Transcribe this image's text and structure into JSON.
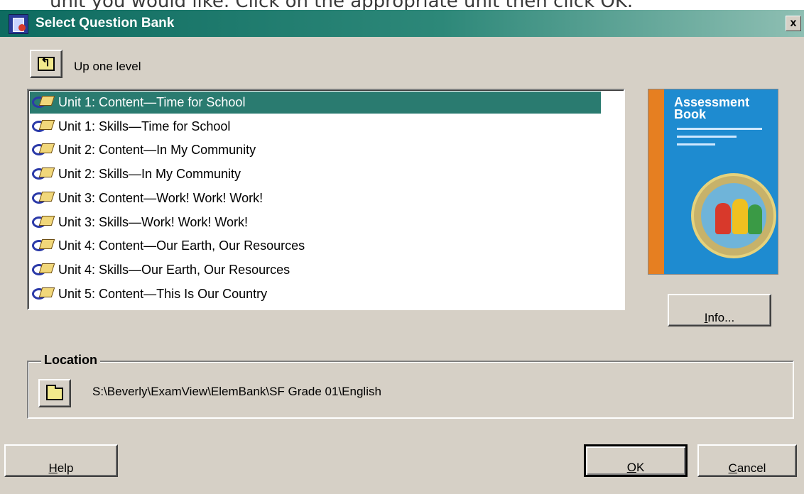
{
  "background_caption": "unit you would like. Click on the appropriate unit then click OK.",
  "window": {
    "title": "Select Question Bank",
    "close_glyph": "x"
  },
  "toolbar": {
    "up_label": "Up one level"
  },
  "list": {
    "items": [
      {
        "label": "Unit 1:  Content—Time for School",
        "selected": true
      },
      {
        "label": "Unit 1:  Skills—Time for School",
        "selected": false
      },
      {
        "label": "Unit 2:  Content—In My Community",
        "selected": false
      },
      {
        "label": "Unit 2:  Skills—In My Community",
        "selected": false
      },
      {
        "label": "Unit 3:  Content—Work! Work! Work!",
        "selected": false
      },
      {
        "label": "Unit 3:  Skills—Work! Work! Work!",
        "selected": false
      },
      {
        "label": "Unit 4:  Content—Our Earth, Our Resources",
        "selected": false
      },
      {
        "label": "Unit 4:  Skills—Our Earth, Our Resources",
        "selected": false
      },
      {
        "label": "Unit 5:  Content—This Is Our Country",
        "selected": false
      }
    ],
    "icon": "question-bank-icon"
  },
  "cover": {
    "title": "Assessment Book",
    "spine_color": "#e67f21",
    "color": "#1e8bd0"
  },
  "buttons": {
    "info": {
      "mnemonic": "I",
      "rest": "nfo..."
    },
    "help": {
      "mnemonic": "H",
      "rest": "elp"
    },
    "ok": {
      "mnemonic": "O",
      "rest": "K"
    },
    "cancel": {
      "mnemonic": "C",
      "rest": "ancel"
    }
  },
  "location": {
    "label": "Location",
    "path": "S:\\Beverly\\ExamView\\ElemBank\\SF Grade 01\\English"
  },
  "colors": {
    "title_bar_start": "#0e6b60",
    "title_bar_end": "#8fbfb3",
    "selection": "#2a7b70",
    "dialog_face": "#d6d0c6"
  }
}
